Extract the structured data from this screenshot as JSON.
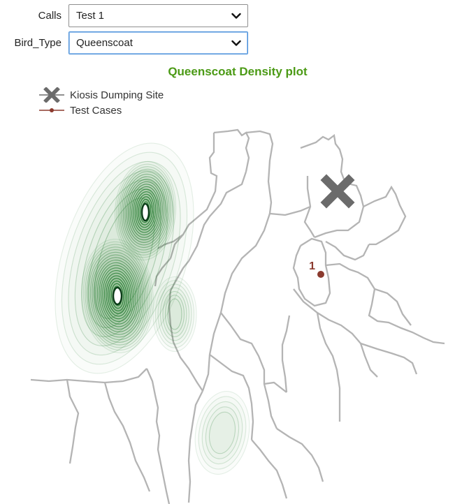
{
  "controls": {
    "calls": {
      "label": "Calls",
      "selected": "Test 1"
    },
    "bird_type": {
      "label": "Bird_Type",
      "selected": "Queenscoat"
    }
  },
  "chart_data": {
    "type": "density-map",
    "title": "Queenscoat Density plot",
    "legend": [
      {
        "label": "Kiosis Dumping Site",
        "marker": "x-cross",
        "color": "#6b6b6b"
      },
      {
        "label": "Test Cases",
        "marker": "line-dot",
        "color": "#8b3a2e"
      }
    ],
    "dumping_site": {
      "marker": "X"
    },
    "test_cases": [
      {
        "label": "1"
      }
    ],
    "density_color": "#1e7a2c",
    "boundary_color": "#b4b4b4",
    "density_peaks": 2
  }
}
